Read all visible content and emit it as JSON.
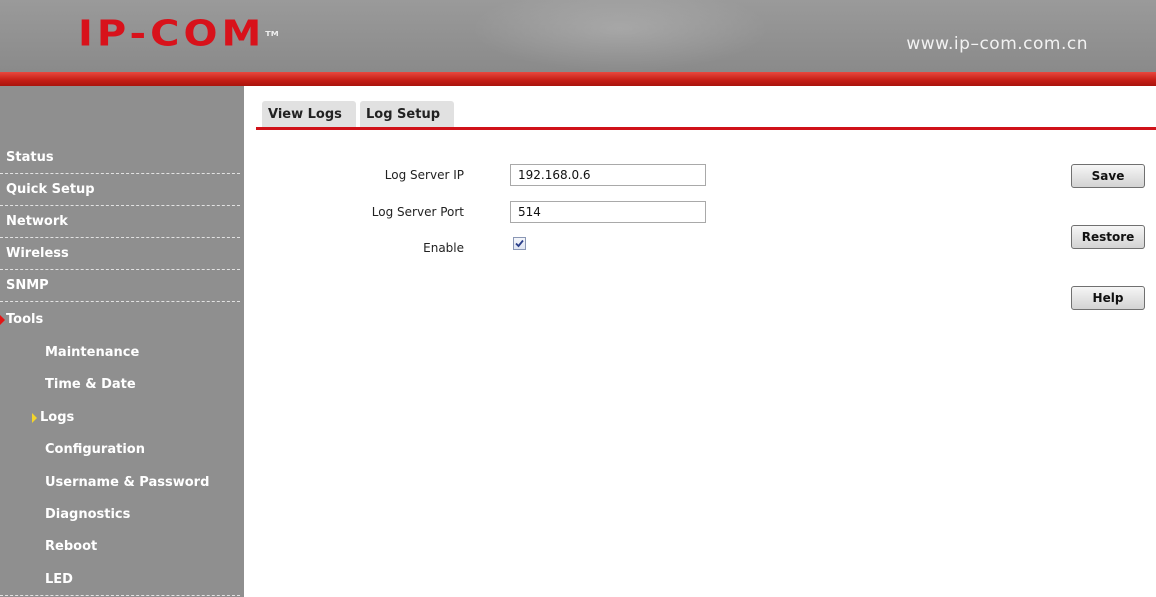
{
  "header": {
    "logo_text": "IP-COM",
    "site_url": "www.ip–com.com.cn"
  },
  "sidebar": {
    "items": [
      {
        "label": "Status"
      },
      {
        "label": "Quick Setup"
      },
      {
        "label": "Network"
      },
      {
        "label": "Wireless"
      },
      {
        "label": "SNMP"
      },
      {
        "label": "Tools",
        "expanded": true
      }
    ],
    "sub_items": [
      {
        "label": "Maintenance"
      },
      {
        "label": "Time & Date"
      },
      {
        "label": "Logs",
        "active": true
      },
      {
        "label": "Configuration"
      },
      {
        "label": "Username & Password"
      },
      {
        "label": "Diagnostics"
      },
      {
        "label": "Reboot"
      },
      {
        "label": "LED"
      }
    ]
  },
  "tabs": [
    {
      "label": "View Logs"
    },
    {
      "label": "Log Setup",
      "active": true
    }
  ],
  "form": {
    "log_server_ip": {
      "label": "Log Server IP",
      "value": "192.168.0.6"
    },
    "log_server_port": {
      "label": "Log Server Port",
      "value": "514"
    },
    "enable": {
      "label": "Enable",
      "checked": true
    }
  },
  "actions": {
    "save": "Save",
    "restore": "Restore",
    "help": "Help"
  },
  "colors": {
    "brand_red": "#d01219",
    "sidebar_bg": "#8f8f8f",
    "header_bg": "#8a8a8a"
  }
}
